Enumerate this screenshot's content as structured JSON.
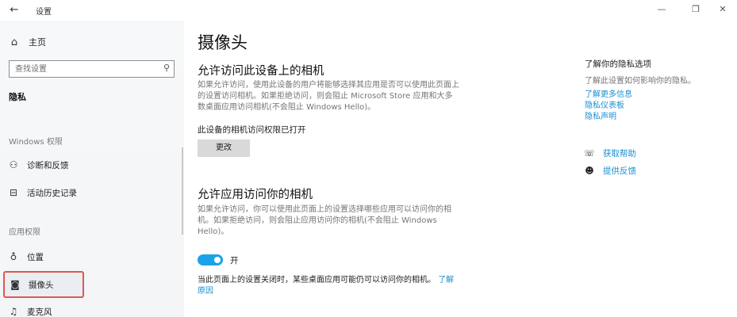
{
  "titlebar": {
    "back_icon": "arrow-left-icon",
    "title": "设置",
    "minimize_glyph": "—",
    "maximize_glyph": "❐",
    "close_glyph": "✕"
  },
  "sidebar": {
    "home": {
      "icon": "home-icon",
      "label": "主页"
    },
    "search": {
      "placeholder": "查找设置",
      "icon": "search-icon"
    },
    "category": "隐私",
    "windows_section": "Windows 权限",
    "windows_items": [
      {
        "icon": "diagnostics-icon",
        "label": "诊断和反馈"
      },
      {
        "icon": "activity-history-icon",
        "label": "活动历史记录"
      }
    ],
    "app_section": "应用权限",
    "app_items": [
      {
        "icon": "location-icon",
        "label": "位置"
      },
      {
        "icon": "camera-icon",
        "label": "摄像头",
        "selected": true
      },
      {
        "icon": "microphone-icon",
        "label": "麦克风"
      }
    ]
  },
  "main": {
    "title": "摄像头",
    "section1": {
      "heading": "允许访问此设备上的相机",
      "description": "如果允许访问，使用此设备的用户将能够选择其应用是否可以使用此页面上的设置访问相机。如果拒绝访问，则会阻止 Microsoft Store 应用和大多数桌面应用访问相机(不会阻止 Windows Hello)。",
      "status": "此设备的相机访问权限已打开",
      "change_button": "更改"
    },
    "section2": {
      "heading": "允许应用访问你的相机",
      "description": "如果允许访问，你可以使用此页面上的设置选择哪些应用可以访问你的相机。如果拒绝访问，则会阻止应用访问你的相机(不会阻止 Windows Hello)。",
      "toggle_state": "开",
      "toggle_on": true,
      "note": "当此页面上的设置关闭时，某些桌面应用可能仍可以访问你的相机。",
      "note_link": "了解原因"
    }
  },
  "right_panel": {
    "title": "了解你的隐私选项",
    "subtitle": "了解此设置如何影响你的隐私。",
    "links": [
      "了解更多信息",
      "隐私仪表板",
      "隐私声明"
    ],
    "help": {
      "icon": "help-chat-icon",
      "label": "获取帮助"
    },
    "feedback": {
      "icon": "feedback-icon",
      "label": "提供反馈"
    }
  },
  "colors": {
    "accent": "#1a8fd1",
    "toggle_on": "#1aa3e8",
    "selection_outline": "#e0584d"
  }
}
